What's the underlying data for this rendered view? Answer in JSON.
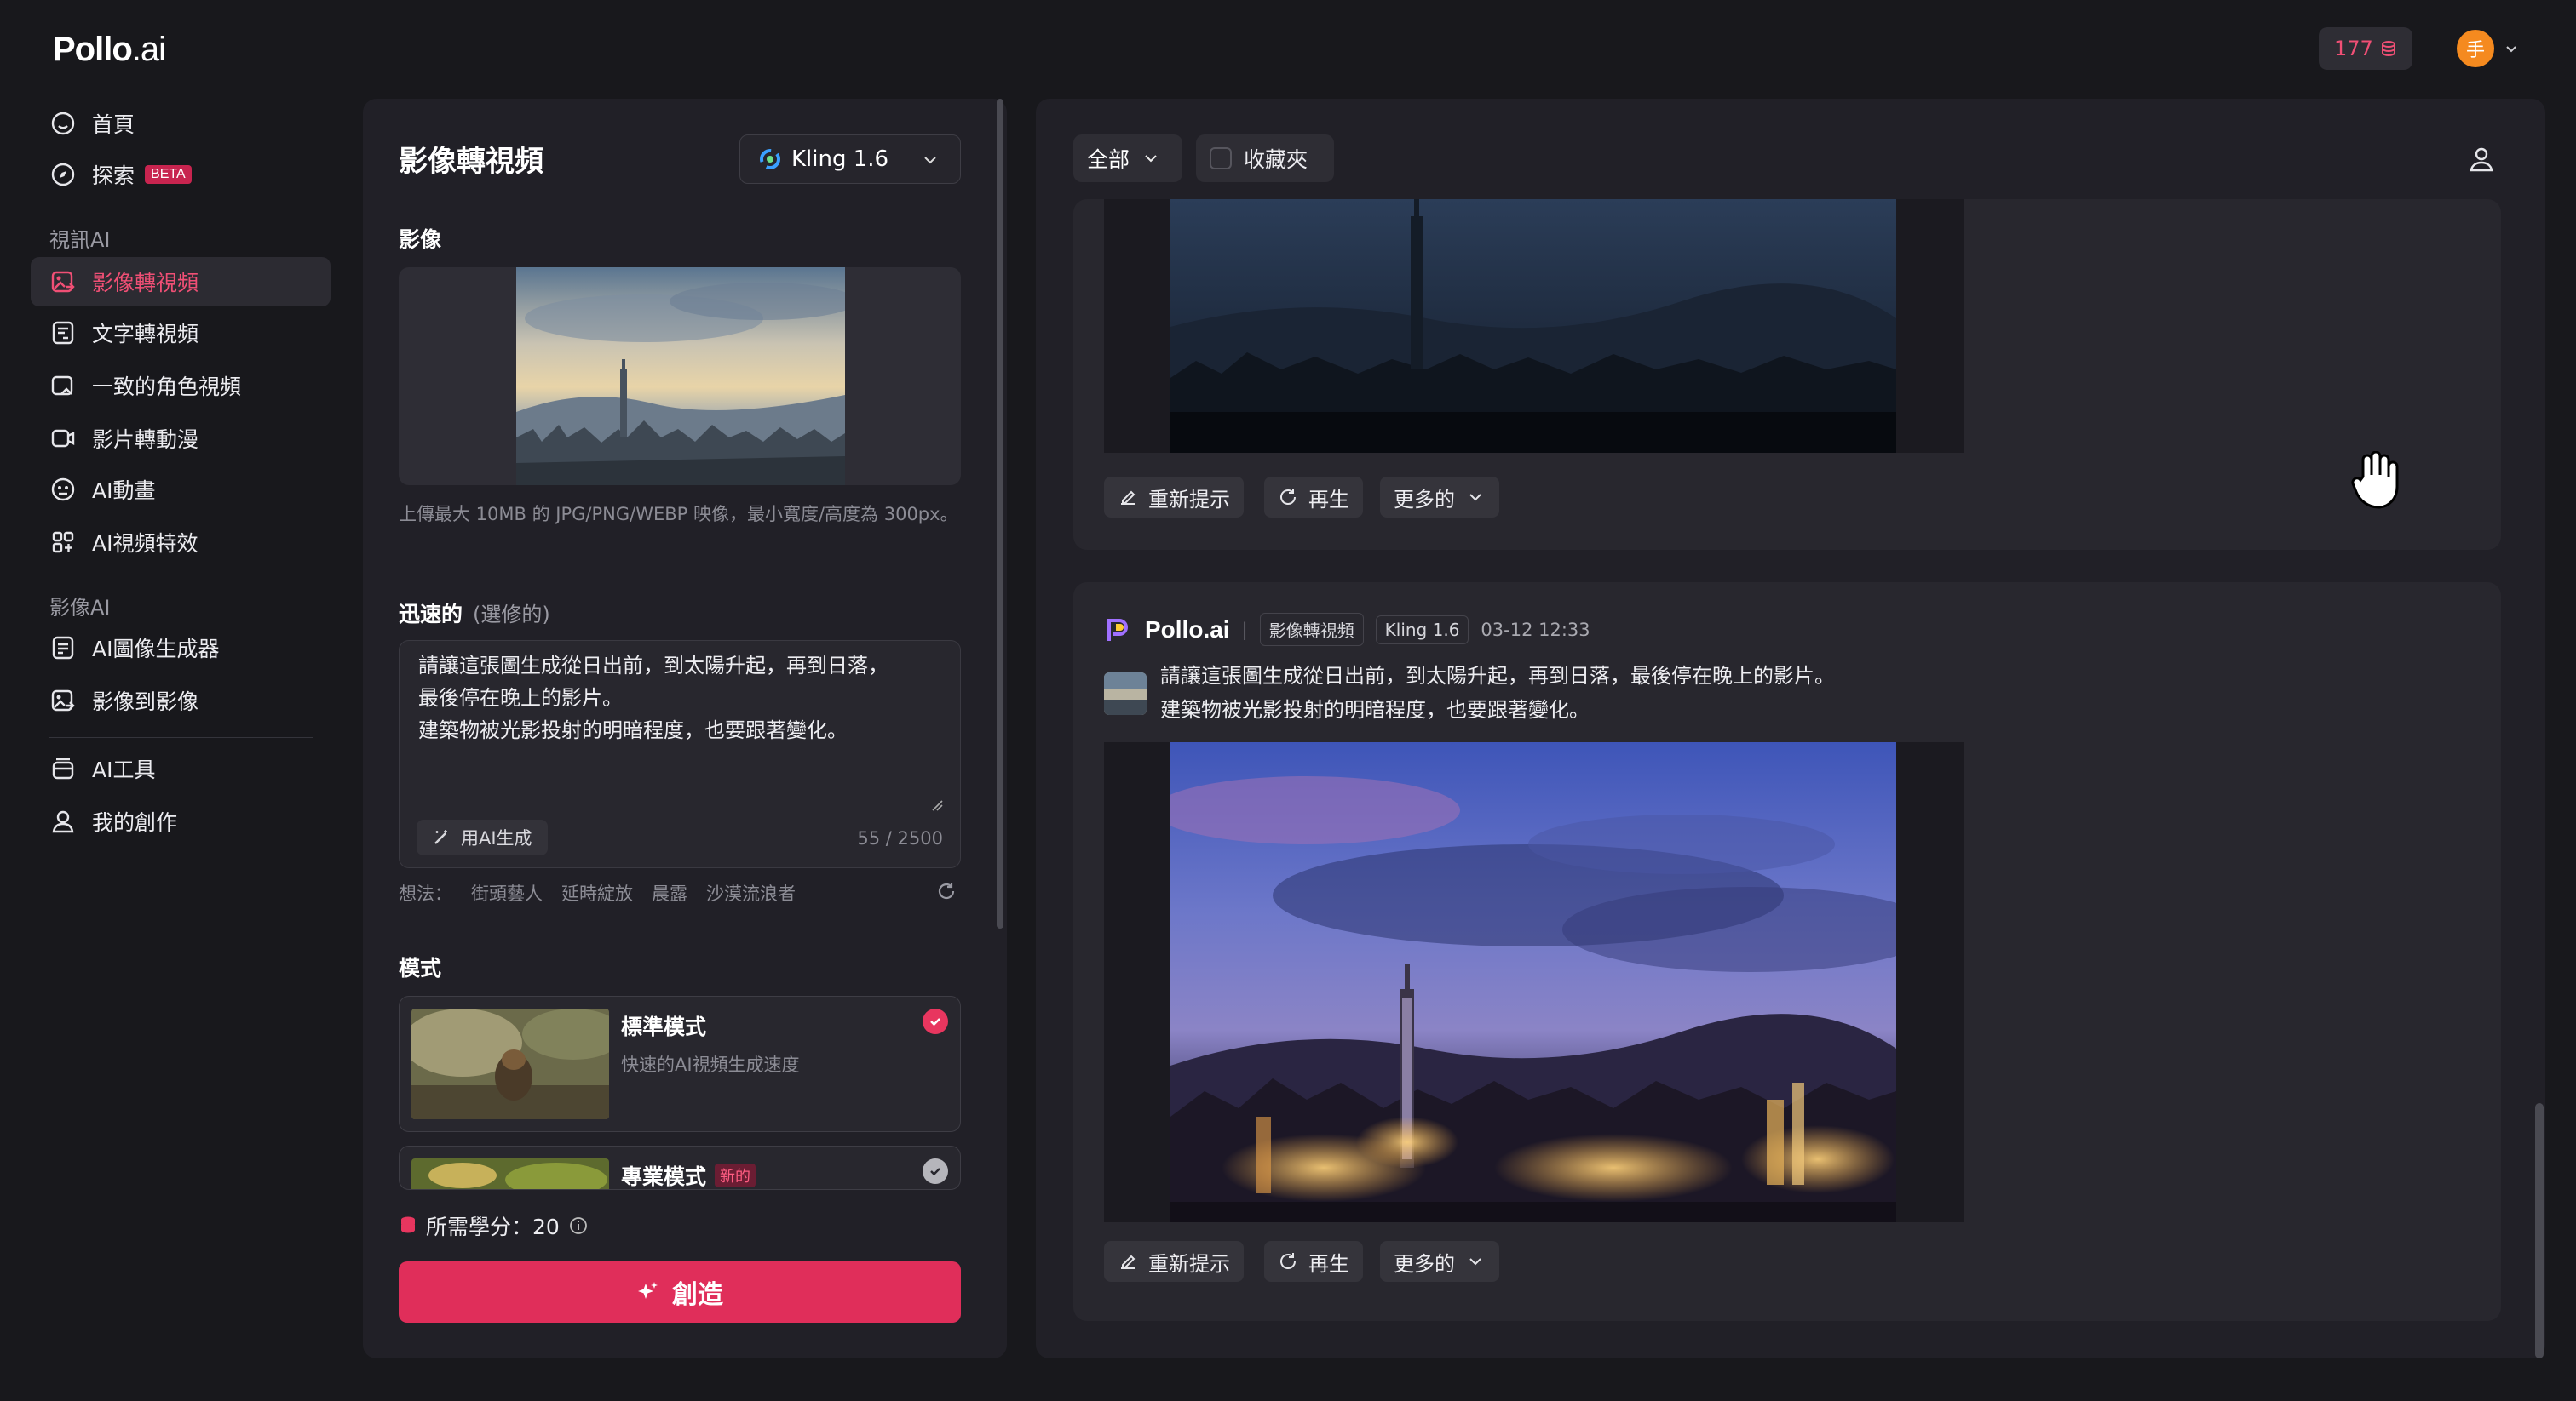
{
  "brand": {
    "name_bold": "Pollo",
    "name_suffix": ".ai"
  },
  "header": {
    "credits": "177",
    "avatar_initial": "手"
  },
  "sidebar": {
    "items": [
      {
        "label": "首頁",
        "icon": "home-icon"
      },
      {
        "label": "探索",
        "icon": "compass-icon",
        "badge": "BETA"
      }
    ],
    "section_video": "視訊AI",
    "video_items": [
      {
        "label": "影像轉視頻",
        "icon": "image-to-video-icon",
        "active": true
      },
      {
        "label": "文字轉視頻",
        "icon": "text-to-video-icon"
      },
      {
        "label": "一致的角色視頻",
        "icon": "character-video-icon"
      },
      {
        "label": "影片轉動漫",
        "icon": "video-to-anime-icon"
      },
      {
        "label": "AI動畫",
        "icon": "animation-icon"
      },
      {
        "label": "AI視頻特效",
        "icon": "effects-icon"
      }
    ],
    "section_image": "影像AI",
    "image_items": [
      {
        "label": "AI圖像生成器",
        "icon": "image-generator-icon"
      },
      {
        "label": "影像到影像",
        "icon": "image-to-image-icon"
      }
    ],
    "bottom_items": [
      {
        "label": "AI工具",
        "icon": "tools-icon"
      },
      {
        "label": "我的創作",
        "icon": "my-creations-icon"
      }
    ]
  },
  "left_panel": {
    "title": "影像轉視頻",
    "model": "Kling 1.6",
    "image_label": "影像",
    "upload_hint": "上傳最大 10MB 的 JPG/PNG/WEBP 映像，最小寬度/高度為 300px。",
    "prompt_label": "迅速的",
    "prompt_optional": "(選修的)",
    "prompt_text": "請讓這張圖生成從日出前，到太陽升起，再到日落，\n最後停在晚上的影片。\n建築物被光影投射的明暗程度，也要跟著變化。",
    "ai_generate": "用AI生成",
    "counter": "55 / 2500",
    "ideas_label": "想法：",
    "ideas": [
      "街頭藝人",
      "延時綻放",
      "晨露",
      "沙漠流浪者"
    ],
    "mode_label": "模式",
    "modes": [
      {
        "title": "標準模式",
        "desc": "快速的AI視頻生成速度",
        "selected": true
      },
      {
        "title": "專業模式",
        "tag": "新的",
        "selected": false
      }
    ],
    "credits_required": "所需學分：20",
    "create": "創造"
  },
  "right_panel": {
    "filter_all": "全部",
    "filter_favorites": "收藏夾",
    "actions": {
      "reprompt": "重新提示",
      "regenerate": "再生",
      "more": "更多的"
    },
    "card": {
      "brand": "Pollo.ai",
      "type": "影像轉視頻",
      "model": "Kling 1.6",
      "time": "03-12 12:33",
      "prompt": "請讓這張圖生成從日出前，到太陽升起，再到日落，最後停在晚上的影片。\n建築物被光影投射的明暗程度，也要跟著變化。"
    }
  },
  "colors": {
    "accent": "#e02e5a",
    "active_text": "#f04f75",
    "panel": "#212027",
    "card": "#28272e"
  }
}
